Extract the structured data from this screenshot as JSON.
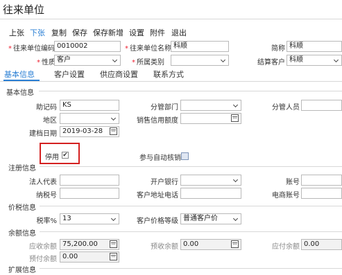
{
  "window": {
    "title": "往来单位"
  },
  "toolbar": {
    "prev": "上张",
    "next": "下张",
    "copy": "复制",
    "save": "保存",
    "save_new": "保存新增",
    "settings": "设置",
    "attachment": "附件",
    "exit": "退出"
  },
  "header": {
    "code_label": "往来单位编码",
    "code_value": "0010002",
    "name_label": "往来单位名称",
    "name_value": "科顺",
    "short_label": "简称",
    "short_value": "科顺",
    "type_label": "性质",
    "type_value": "客户",
    "category_label": "所属类别",
    "category_value": "",
    "settle_label": "结算客户",
    "settle_value": "科顺"
  },
  "tabs": [
    "基本信息",
    "客户设置",
    "供应商设置",
    "联系方式"
  ],
  "basic": {
    "section": "基本信息",
    "mnemonic_label": "助记码",
    "mnemonic_value": "KS",
    "dept_label": "分管部门",
    "dept_value": "",
    "staff_label": "分管人员",
    "staff_value": "",
    "region_label": "地区",
    "region_value": "",
    "credit_label": "销售信用额度",
    "credit_value": "",
    "date_label": "建档日期",
    "date_value": "2019-03-28",
    "disabled_label": "停用",
    "disabled_mark": "✔",
    "auto_verify_label": "参与自动核销"
  },
  "register": {
    "section": "注册信息",
    "legal_label": "法人代表",
    "legal_value": "",
    "bank_label": "开户银行",
    "bank_value": "",
    "account_label": "账号",
    "account_value": "",
    "tax_label": "纳税号",
    "tax_value": "",
    "addr_label": "客户地址电话",
    "addr_value": "",
    "ecomm_label": "电商账号",
    "ecomm_value": ""
  },
  "price": {
    "section": "价税信息",
    "rate_label": "税率%",
    "rate_value": "13",
    "level_label": "客户价格等级",
    "level_value": "普通客户价"
  },
  "balance": {
    "section": "余额信息",
    "ar_label": "应收余额",
    "ar_value": "75,200.00",
    "pre_recv_label": "预收余额",
    "pre_recv_value": "0.00",
    "ap_label": "应付余额",
    "ap_value": "0.00",
    "pre_pay_label": "预付余额",
    "pre_pay_value": "0.00"
  },
  "extend": {
    "section": "扩展信息"
  },
  "colors": {
    "accent": "#2a7fd4",
    "required": "#e23",
    "highlight_box": "#d42020"
  }
}
